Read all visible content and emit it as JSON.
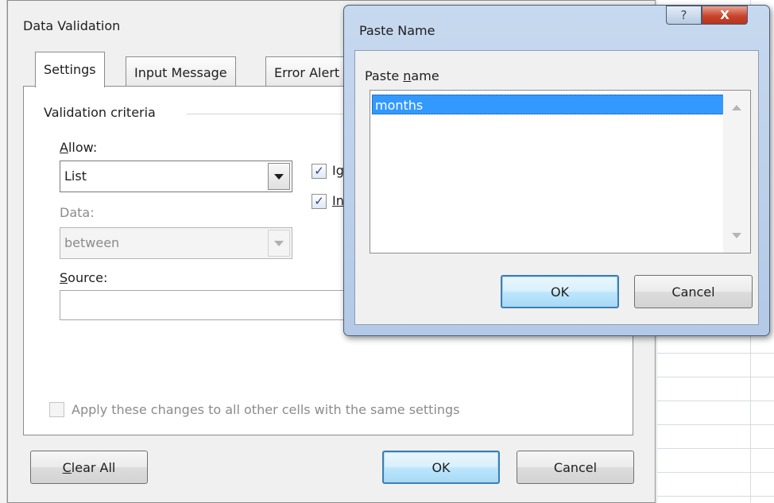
{
  "main_dialog": {
    "title": "Data Validation",
    "tabs": [
      {
        "label": "Settings",
        "active": true
      },
      {
        "label": "Input Message",
        "active": false
      },
      {
        "label": "Error Alert",
        "active": false
      }
    ],
    "group_label": "Validation criteria",
    "allow": {
      "label": "Allow:",
      "value": "List"
    },
    "data": {
      "label": "Data:",
      "value": "between"
    },
    "source": {
      "label": "Source:",
      "value": ""
    },
    "ignore_blank": {
      "label": "Ignore blank",
      "checked": true
    },
    "in_cell_dropdown": {
      "label": "In-cell dropdown",
      "checked": true
    },
    "apply_all": {
      "label": "Apply these changes to all other cells with the same settings",
      "checked": false
    },
    "buttons": {
      "clear_all": "Clear All",
      "ok": "OK",
      "cancel": "Cancel"
    }
  },
  "paste_name_dialog": {
    "title": "Paste Name",
    "help_icon": "?",
    "close_icon": "X",
    "list_label": "Paste name",
    "items": [
      "months"
    ],
    "selected_index": 0,
    "buttons": {
      "ok": "OK",
      "cancel": "Cancel"
    }
  },
  "colors": {
    "selection": "#3399ff",
    "default_button_border": "#3c7fb1",
    "close_button": "#c9442b"
  }
}
